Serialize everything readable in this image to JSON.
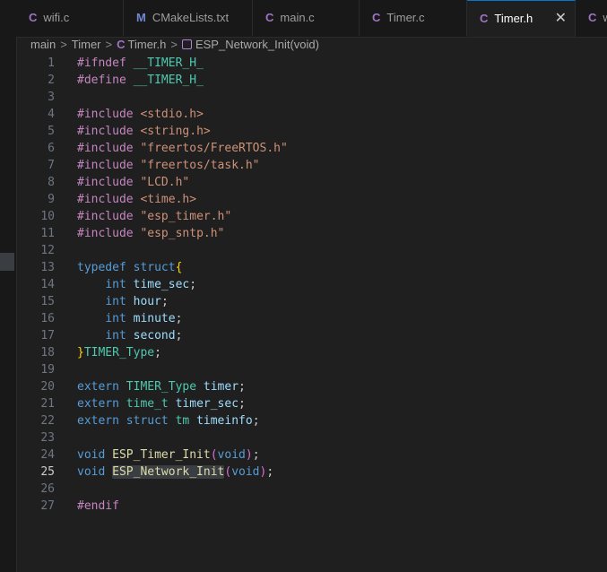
{
  "tabs": [
    {
      "icon": "C",
      "label": "wifi.c",
      "active": false
    },
    {
      "icon": "M",
      "label": "CMakeLists.txt",
      "active": false
    },
    {
      "icon": "C",
      "label": "main.c",
      "active": false
    },
    {
      "icon": "C",
      "label": "Timer.c",
      "active": false
    },
    {
      "icon": "C",
      "label": "Timer.h",
      "active": true,
      "close": "✕"
    },
    {
      "icon": "C",
      "label": "w",
      "active": false
    }
  ],
  "breadcrumb": {
    "folder1": "main",
    "folder2": "Timer",
    "file_icon": "C",
    "file": "Timer.h",
    "symbol": "ESP_Network_Init(void)",
    "separator": ">"
  },
  "editor": {
    "active_line": 25,
    "lines": [
      {
        "n": "1",
        "tokens": [
          [
            "pp",
            "#ifndef "
          ],
          [
            "ty",
            "__TIMER_H_"
          ]
        ]
      },
      {
        "n": "2",
        "tokens": [
          [
            "pp",
            "#define "
          ],
          [
            "ty",
            "__TIMER_H_"
          ]
        ]
      },
      {
        "n": "3",
        "tokens": []
      },
      {
        "n": "4",
        "tokens": [
          [
            "pp",
            "#include "
          ],
          [
            "str",
            "<stdio.h>"
          ]
        ]
      },
      {
        "n": "5",
        "tokens": [
          [
            "pp",
            "#include "
          ],
          [
            "str",
            "<string.h>"
          ]
        ]
      },
      {
        "n": "6",
        "tokens": [
          [
            "pp",
            "#include "
          ],
          [
            "str",
            "\"freertos/FreeRTOS.h\""
          ]
        ]
      },
      {
        "n": "7",
        "tokens": [
          [
            "pp",
            "#include "
          ],
          [
            "str",
            "\"freertos/task.h\""
          ]
        ]
      },
      {
        "n": "8",
        "tokens": [
          [
            "pp",
            "#include "
          ],
          [
            "str",
            "\"LCD.h\""
          ]
        ]
      },
      {
        "n": "9",
        "tokens": [
          [
            "pp",
            "#include "
          ],
          [
            "str",
            "<time.h>"
          ]
        ]
      },
      {
        "n": "10",
        "tokens": [
          [
            "pp",
            "#include "
          ],
          [
            "str",
            "\"esp_timer.h\""
          ]
        ]
      },
      {
        "n": "11",
        "tokens": [
          [
            "pp",
            "#include "
          ],
          [
            "str",
            "\"esp_sntp.h\""
          ]
        ]
      },
      {
        "n": "12",
        "tokens": []
      },
      {
        "n": "13",
        "tokens": [
          [
            "kw",
            "typedef"
          ],
          [
            "pl",
            " "
          ],
          [
            "kw",
            "struct"
          ],
          [
            "br",
            "{"
          ]
        ]
      },
      {
        "n": "14",
        "tokens": [
          [
            "pl",
            "    "
          ],
          [
            "kw",
            "int"
          ],
          [
            "pl",
            " "
          ],
          [
            "var",
            "time_sec"
          ],
          [
            "pl",
            ";"
          ]
        ]
      },
      {
        "n": "15",
        "tokens": [
          [
            "pl",
            "    "
          ],
          [
            "kw",
            "int"
          ],
          [
            "pl",
            " "
          ],
          [
            "var",
            "hour"
          ],
          [
            "pl",
            ";"
          ]
        ]
      },
      {
        "n": "16",
        "tokens": [
          [
            "pl",
            "    "
          ],
          [
            "kw",
            "int"
          ],
          [
            "pl",
            " "
          ],
          [
            "var",
            "minute"
          ],
          [
            "pl",
            ";"
          ]
        ]
      },
      {
        "n": "17",
        "tokens": [
          [
            "pl",
            "    "
          ],
          [
            "kw",
            "int"
          ],
          [
            "pl",
            " "
          ],
          [
            "var",
            "second"
          ],
          [
            "pl",
            ";"
          ]
        ]
      },
      {
        "n": "18",
        "tokens": [
          [
            "br",
            "}"
          ],
          [
            "ty",
            "TIMER_Type"
          ],
          [
            "pl",
            ";"
          ]
        ]
      },
      {
        "n": "19",
        "tokens": []
      },
      {
        "n": "20",
        "tokens": [
          [
            "kw",
            "extern"
          ],
          [
            "pl",
            " "
          ],
          [
            "ty",
            "TIMER_Type"
          ],
          [
            "pl",
            " "
          ],
          [
            "var",
            "timer"
          ],
          [
            "pl",
            ";"
          ]
        ]
      },
      {
        "n": "21",
        "tokens": [
          [
            "kw",
            "extern"
          ],
          [
            "pl",
            " "
          ],
          [
            "ty",
            "time_t"
          ],
          [
            "pl",
            " "
          ],
          [
            "var",
            "timer_sec"
          ],
          [
            "pl",
            ";"
          ]
        ]
      },
      {
        "n": "22",
        "tokens": [
          [
            "kw",
            "extern"
          ],
          [
            "pl",
            " "
          ],
          [
            "kw",
            "struct"
          ],
          [
            "pl",
            " "
          ],
          [
            "ty",
            "tm"
          ],
          [
            "pl",
            " "
          ],
          [
            "var",
            "timeinfo"
          ],
          [
            "pl",
            ";"
          ]
        ]
      },
      {
        "n": "23",
        "tokens": []
      },
      {
        "n": "24",
        "tokens": [
          [
            "kw",
            "void"
          ],
          [
            "pl",
            " "
          ],
          [
            "fn",
            "ESP_Timer_Init"
          ],
          [
            "br2",
            "("
          ],
          [
            "kw",
            "void"
          ],
          [
            "br2",
            ")"
          ],
          [
            "pl",
            ";"
          ]
        ]
      },
      {
        "n": "25",
        "tokens": [
          [
            "kw",
            "void"
          ],
          [
            "pl",
            " "
          ],
          [
            "fn hl",
            "ESP_Network_Init"
          ],
          [
            "br2",
            "("
          ],
          [
            "kw",
            "void"
          ],
          [
            "br2",
            ")"
          ],
          [
            "pl",
            ";"
          ]
        ]
      },
      {
        "n": "26",
        "tokens": []
      },
      {
        "n": "27",
        "tokens": [
          [
            "pp",
            "#endif"
          ]
        ]
      }
    ]
  }
}
